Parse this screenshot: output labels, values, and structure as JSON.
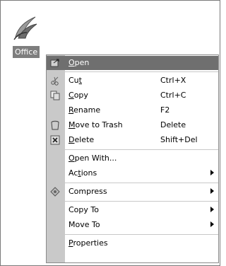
{
  "desktop": {
    "icon_label": "Office",
    "icon": "office-suite-icon"
  },
  "menu": {
    "items": [
      {
        "label_pre": "",
        "label_ul": "O",
        "label_post": "pen",
        "accel": "",
        "icon": "open-icon",
        "selected": true
      },
      {
        "label_pre": "Cu",
        "label_ul": "t",
        "label_post": "",
        "accel": "Ctrl+X",
        "icon": "scissors-icon"
      },
      {
        "label_pre": "",
        "label_ul": "C",
        "label_post": "opy",
        "accel": "Ctrl+C",
        "icon": "copy-icon"
      },
      {
        "label_pre": "",
        "label_ul": "R",
        "label_post": "ename",
        "accel": "F2",
        "icon": ""
      },
      {
        "label_pre": "",
        "label_ul": "M",
        "label_post": "ove to Trash",
        "accel": "Delete",
        "icon": "trash-icon"
      },
      {
        "label_pre": "",
        "label_ul": "D",
        "label_post": "elete",
        "accel": "Shift+Del",
        "icon": "delete-icon"
      },
      {
        "label_pre": "",
        "label_ul": "O",
        "label_post": "pen With...",
        "accel": "",
        "icon": ""
      },
      {
        "label_pre": "Ac",
        "label_ul": "t",
        "label_post": "ions",
        "accel": "",
        "icon": "",
        "submenu": true
      },
      {
        "label_pre": "Compress",
        "label_ul": "",
        "label_post": "",
        "accel": "",
        "icon": "compress-icon",
        "submenu": true
      },
      {
        "label_pre": "Copy To",
        "label_ul": "",
        "label_post": "",
        "accel": "",
        "icon": "",
        "submenu": true
      },
      {
        "label_pre": "Move To",
        "label_ul": "",
        "label_post": "",
        "accel": "",
        "icon": "",
        "submenu": true
      },
      {
        "label_pre": "",
        "label_ul": "P",
        "label_post": "roperties",
        "accel": "",
        "icon": ""
      }
    ]
  }
}
